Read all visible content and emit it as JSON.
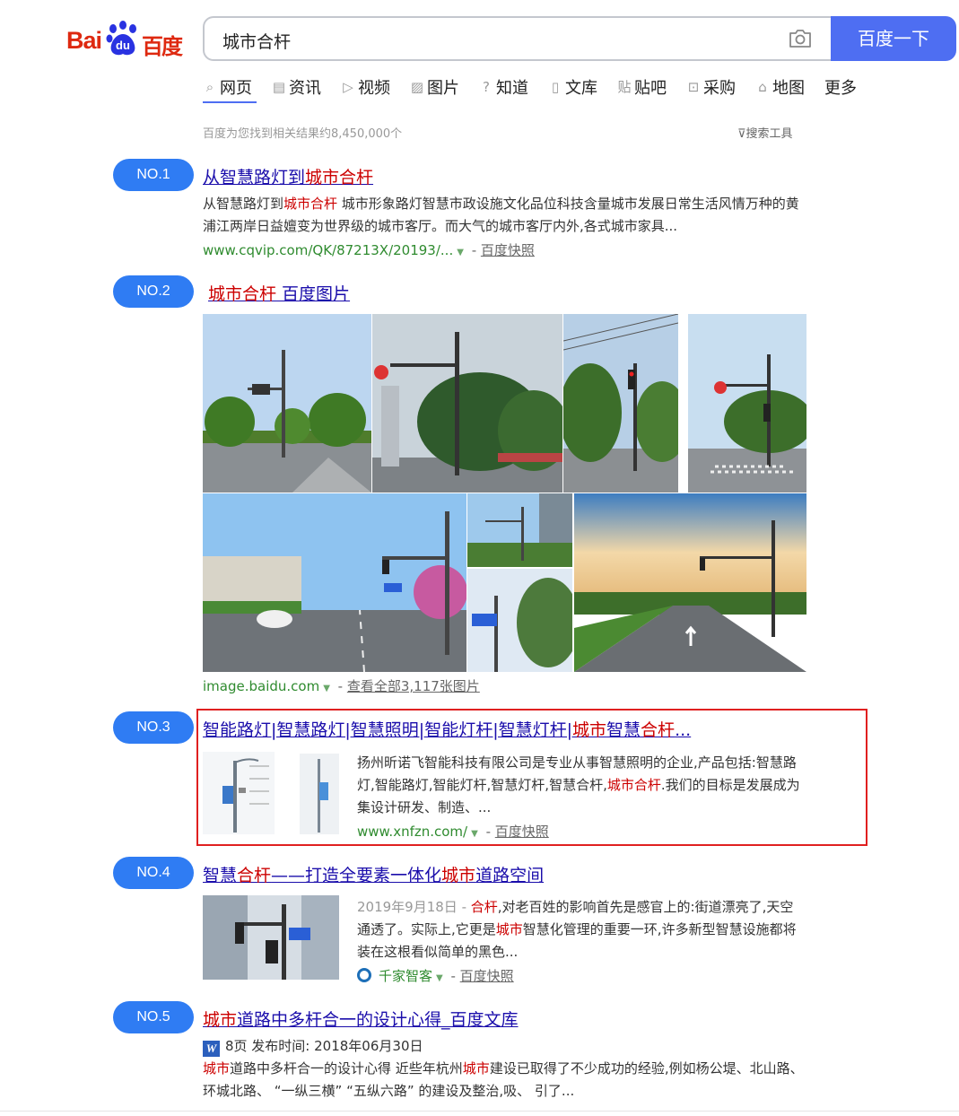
{
  "logo": {
    "latin": "Bai",
    "du": "du",
    "cn": "百度"
  },
  "search": {
    "query": "城市合杆",
    "button": "百度一下"
  },
  "tabs": [
    "网页",
    "资讯",
    "视频",
    "图片",
    "知道",
    "文库",
    "贴吧",
    "采购",
    "地图",
    "更多"
  ],
  "result_count": "百度为您找到相关结果约8,450,000个",
  "search_tools": "搜索工具",
  "results": [
    {
      "badge": "NO.1",
      "title_a": "从智慧路灯到",
      "title_b": "城市合杆",
      "abs_a": "从智慧路灯到",
      "abs_hl": "城市合杆",
      "abs_b": " 城市形象路灯智慧市政设施文化品位科技含量城市发展日常生活风情万种的黄浦江两岸日益嬗变为世界级的城市客厅。而大气的城市客厅内外,各式城市家具...",
      "url": "www.cqvip.com/QK/87213X/20193/...",
      "snap": "百度快照"
    },
    {
      "badge": "NO.2",
      "title_a": "城市合杆",
      "title_b": " 百度图片",
      "url": "image.baidu.com",
      "more": "查看全部3,117张图片"
    },
    {
      "badge": "NO.3",
      "title_a": "智能路灯|智慧路灯|智慧照明|智能灯杆|智慧灯杆|",
      "title_b": "城市",
      "title_c": "智慧",
      "title_d": "合杆",
      "title_e": "...",
      "abs_a": "扬州昕诺飞智能科技有限公司是专业从事智慧照明的企业,产品包括:智慧路灯,智能路灯,智能灯杆,智慧灯杆,智慧合杆,",
      "abs_hl": "城市合杆",
      "abs_b": ".我们的目标是发展成为集设计研发、制造、...",
      "url": "www.xnfzn.com/",
      "snap": "百度快照"
    },
    {
      "badge": "NO.4",
      "title_a": "智慧",
      "title_b": "合杆",
      "title_c": "——打造全要素一体化",
      "title_d": "城市",
      "title_e": "道路空间",
      "date": "2019年9月18日 - ",
      "abs_hl1": "合杆",
      "abs_a": ",对老百姓的影响首先是感官上的:街道漂亮了,天空通透了。实际上,它更是",
      "abs_hl2": "城市",
      "abs_b": "智慧化管理的重要一环,许多新型智慧设施都将装在这根看似简单的黑色...",
      "source": "千家智客",
      "snap": "百度快照"
    },
    {
      "badge": "NO.5",
      "title_a": "城市",
      "title_b": "道路中多杆合一的设计心得_百度文库",
      "meta": "8页 发布时间: 2018年06月30日",
      "abs_hl1": "城市",
      "abs_a": "道路中多杆合一的设计心得 近些年杭州",
      "abs_hl2": "城市",
      "abs_b": "建设已取得了不少成功的经验,例如杨公堤、北山路、环城北路、 “一纵三横” “五纵六路” 的建设及整治,吸、 引了...",
      "doc_icon": "W"
    }
  ],
  "colors": {
    "accent": "#4e6ef2",
    "badge": "#2f7cf3",
    "link": "#1a0dab",
    "highlight": "#cc0000",
    "url": "#2f8b2f"
  }
}
